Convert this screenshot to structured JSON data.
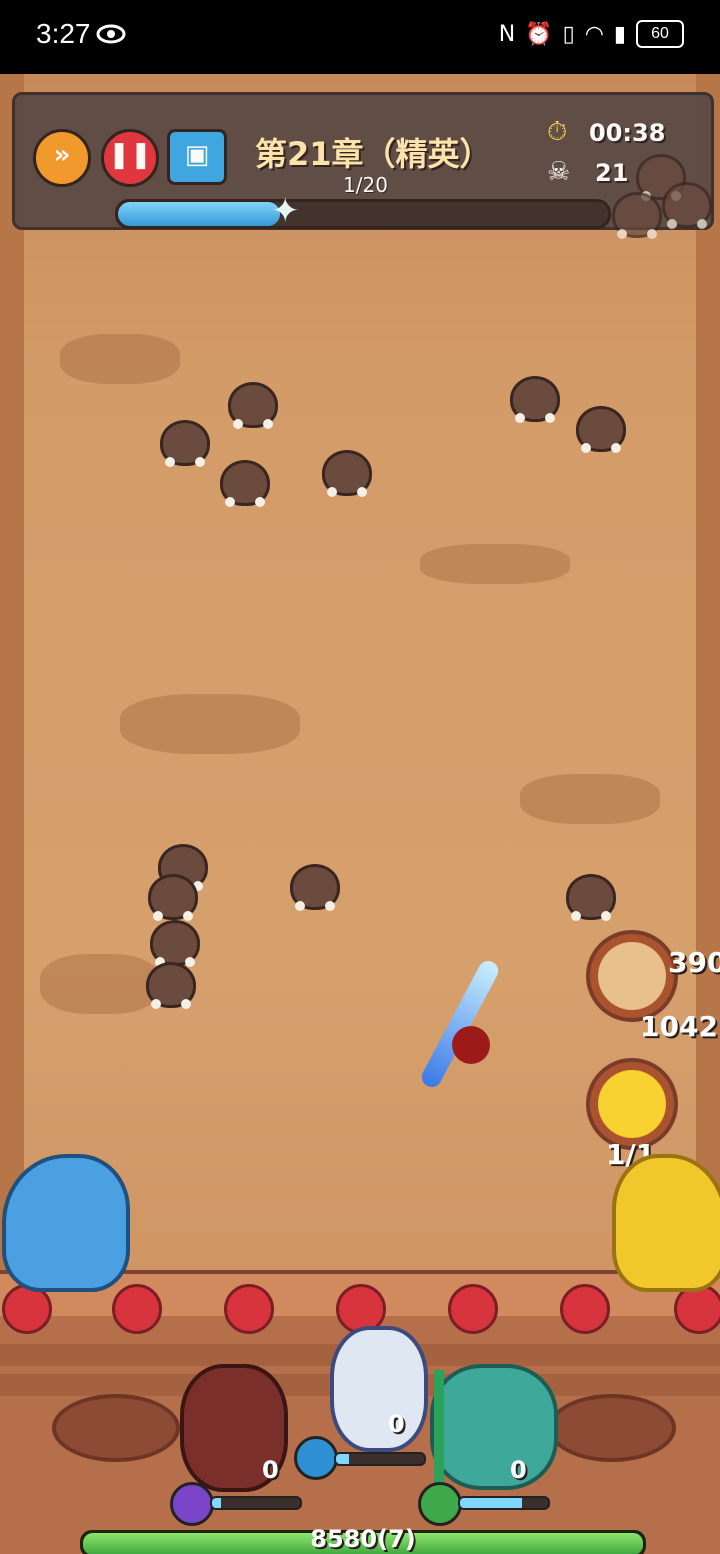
{
  "status_bar": {
    "time": "3:27",
    "battery": "60",
    "icons": [
      "eye-icon",
      "nfc-icon",
      "alarm-icon",
      "vibrate-icon",
      "wifi-icon",
      "signal-4g-icon",
      "battery-icon"
    ]
  },
  "hud": {
    "chapter_title": "第21章（精英）",
    "wave": "1/20",
    "wave_progress": 0.33,
    "timer": "00:38",
    "kills": "21",
    "buttons": {
      "fast_forward_icon": "fast-forward-icon",
      "pause_icon": "pause-icon",
      "card_icon": "card-icon"
    }
  },
  "battle": {
    "hero_portrait_damage_top": "390",
    "hero_portrait_damage_bottom": "1042",
    "skill_counter": "1/1"
  },
  "party": {
    "hero_red_count": "0",
    "hero_white_count": "0",
    "hero_green_count": "0",
    "hero_red_mana": 0.1,
    "hero_white_mana": 0.15,
    "hero_green_mana": 0.7
  },
  "base_hp": {
    "value": "8580",
    "level_text": "(7)"
  }
}
